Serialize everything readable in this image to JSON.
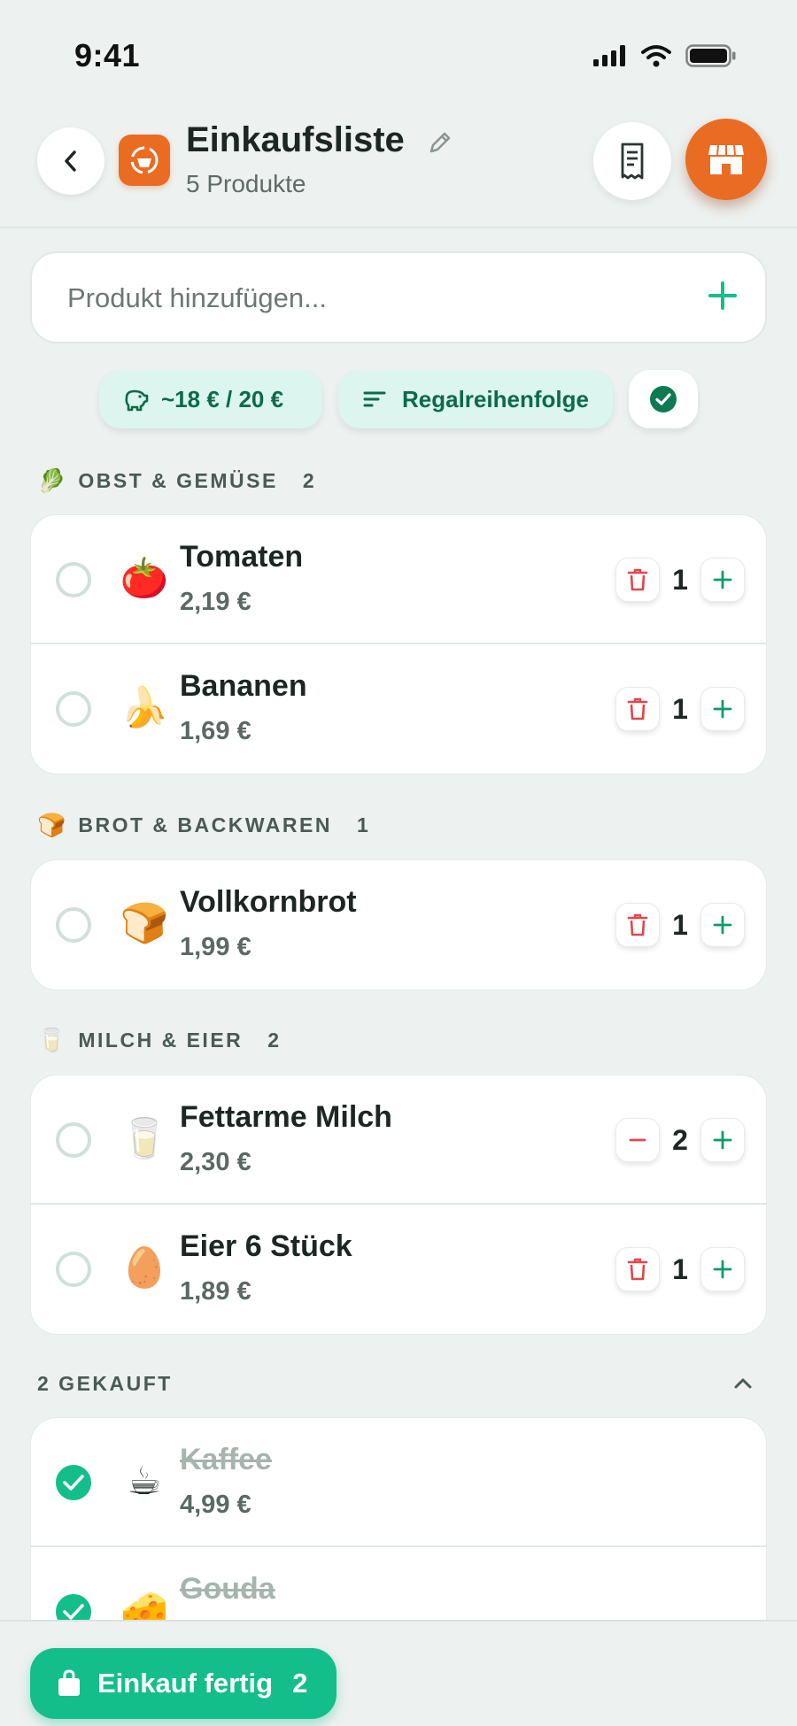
{
  "status_bar": {
    "time": "9:41"
  },
  "header": {
    "title": "Einkaufsliste",
    "subtitle": "5 Produkte"
  },
  "add_product": {
    "placeholder": "Produkt hinzufügen..."
  },
  "chips": {
    "budget": "~18 € / 20 €",
    "sort": "Regalreihenfolge"
  },
  "sections": [
    {
      "emoji": "🥬",
      "title": "OBST & GEMÜSE",
      "count": "2",
      "items": [
        {
          "emoji": "🍅",
          "name": "Tomaten",
          "price": "2,19 €",
          "qty": "1"
        },
        {
          "emoji": "🍌",
          "name": "Bananen",
          "price": "1,69 €",
          "qty": "1"
        }
      ]
    },
    {
      "emoji": "🍞",
      "title": "BROT & BACKWAREN",
      "count": "1",
      "items": [
        {
          "emoji": "🍞",
          "name": "Vollkornbrot",
          "price": "1,99 €",
          "qty": "1"
        }
      ]
    },
    {
      "emoji": "🥛",
      "title": "MILCH & EIER",
      "count": "2",
      "items": [
        {
          "emoji": "🥛",
          "name": "Fettarme Milch",
          "price": "2,30 €",
          "qty": "2"
        },
        {
          "emoji": "🥚",
          "name": "Eier 6 Stück",
          "price": "1,89 €",
          "qty": "1"
        }
      ]
    }
  ],
  "purchased": {
    "title": "2 GEKAUFT",
    "items": [
      {
        "emoji": "☕",
        "name": "Kaffee",
        "price": "4,99 €"
      },
      {
        "emoji": "🧀",
        "name": "Gouda",
        "price": ""
      }
    ]
  },
  "bottom": {
    "finish_label": "Einkauf fertig",
    "finish_count": "2"
  },
  "colors": {
    "accent_green": "#13be8a",
    "brand_orange": "#ea6c23",
    "delete_red": "#e0474a",
    "background": "#edf1f0"
  },
  "icons": {
    "back": "chevron-left-icon",
    "edit": "pencil-icon",
    "receipt": "receipt-icon",
    "store": "store-icon",
    "add": "plus-icon",
    "budget": "piggy-bank-icon",
    "sort": "sort-lines-icon",
    "check": "check-circle-icon",
    "delete": "trash-icon",
    "decrement": "minus-icon",
    "increment": "plus-icon",
    "collapse": "chevron-up-icon",
    "bag": "shopping-bag-icon"
  }
}
